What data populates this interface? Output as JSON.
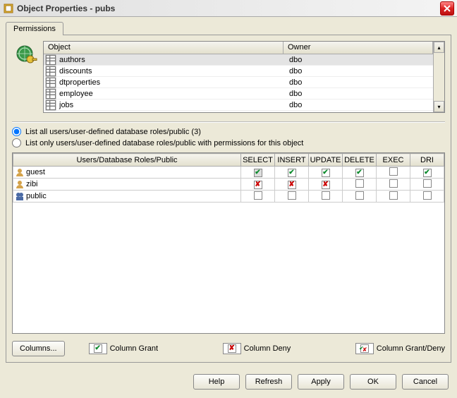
{
  "window": {
    "title": "Object Properties - pubs"
  },
  "tabs": {
    "permissions": "Permissions"
  },
  "object_list": {
    "header_object": "Object",
    "header_owner": "Owner",
    "rows": [
      {
        "name": "authors",
        "owner": "dbo",
        "selected": true
      },
      {
        "name": "discounts",
        "owner": "dbo",
        "selected": false
      },
      {
        "name": "dtproperties",
        "owner": "dbo",
        "selected": false
      },
      {
        "name": "employee",
        "owner": "dbo",
        "selected": false
      },
      {
        "name": "jobs",
        "owner": "dbo",
        "selected": false
      }
    ]
  },
  "radios": {
    "list_all": "List all users/user-defined database roles/public (3)",
    "list_only": "List only users/user-defined database roles/public with permissions for this object"
  },
  "perm": {
    "header_user": "Users/Database Roles/Public",
    "cols": [
      "SELECT",
      "INSERT",
      "UPDATE",
      "DELETE",
      "EXEC",
      "DRI"
    ],
    "rows": [
      {
        "name": "guest",
        "type": "user",
        "cells": [
          "grant-shaded",
          "grant",
          "grant",
          "grant",
          "",
          "grant"
        ]
      },
      {
        "name": "zibi",
        "type": "user",
        "cells": [
          "deny",
          "deny",
          "deny",
          "",
          "",
          ""
        ]
      },
      {
        "name": "public",
        "type": "role",
        "cells": [
          "",
          "",
          "",
          "",
          "",
          ""
        ]
      }
    ]
  },
  "legend": {
    "columns_btn": "Columns...",
    "col_grant": "Column Grant",
    "col_deny": "Column Deny",
    "col_grantdeny": "Column Grant/Deny"
  },
  "footer": {
    "help": "Help",
    "refresh": "Refresh",
    "apply": "Apply",
    "ok": "OK",
    "cancel": "Cancel"
  }
}
